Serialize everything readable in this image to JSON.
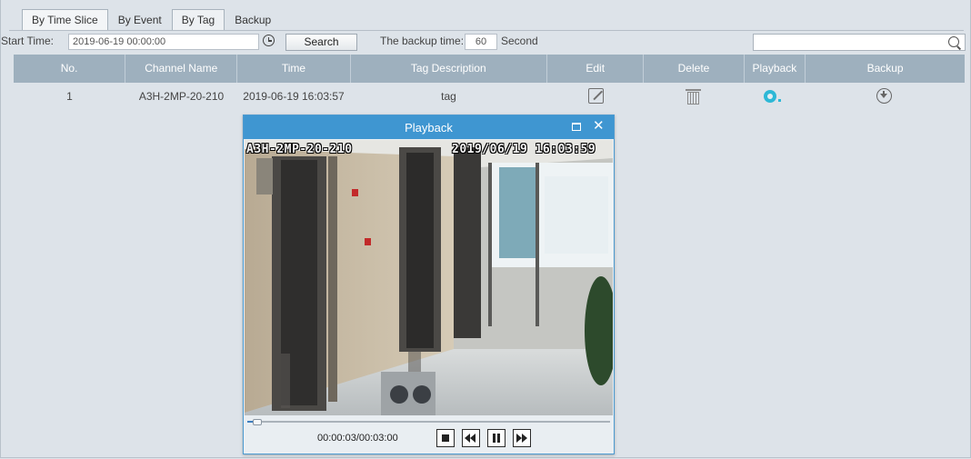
{
  "tabs": [
    {
      "label": "By Time Slice"
    },
    {
      "label": "By Event"
    },
    {
      "label": "By Tag"
    },
    {
      "label": "Backup"
    }
  ],
  "active_tab": "By Tag",
  "toolbar": {
    "start_time_label": "Start Time:",
    "start_time_value": "2019-06-19 00:00:00",
    "search_label": "Search",
    "backup_time_label": "The backup time:",
    "backup_time_value": "60",
    "backup_time_unit": "Second",
    "search_value": ""
  },
  "table": {
    "columns": [
      "No.",
      "Channel Name",
      "Time",
      "Tag Description",
      "Edit",
      "Delete",
      "Playback",
      "Backup"
    ],
    "rows": [
      {
        "no": "1",
        "channel": "A3H-2MP-20-210",
        "time": "2019-06-19 16:03:57",
        "tag": "tag"
      }
    ]
  },
  "playback_dialog": {
    "title": "Playback",
    "osd_channel": "A3H-2MP-20-210",
    "osd_timestamp": "2019/06/19 16:03:59",
    "time_readout": "00:00:03/00:03:00",
    "progress_fraction": 0.017
  },
  "colors": {
    "accent": "#3f96d1",
    "table_header": "#9eb0be",
    "playback_icon": "#2db8d6",
    "background": "#dde3e9"
  },
  "icons": [
    "clock-icon",
    "search-icon",
    "edit-icon",
    "trash-icon",
    "playback-icon",
    "download-icon",
    "maximize-icon",
    "close-icon",
    "stop-icon",
    "rewind-icon",
    "pause-icon",
    "fast-forward-icon"
  ]
}
